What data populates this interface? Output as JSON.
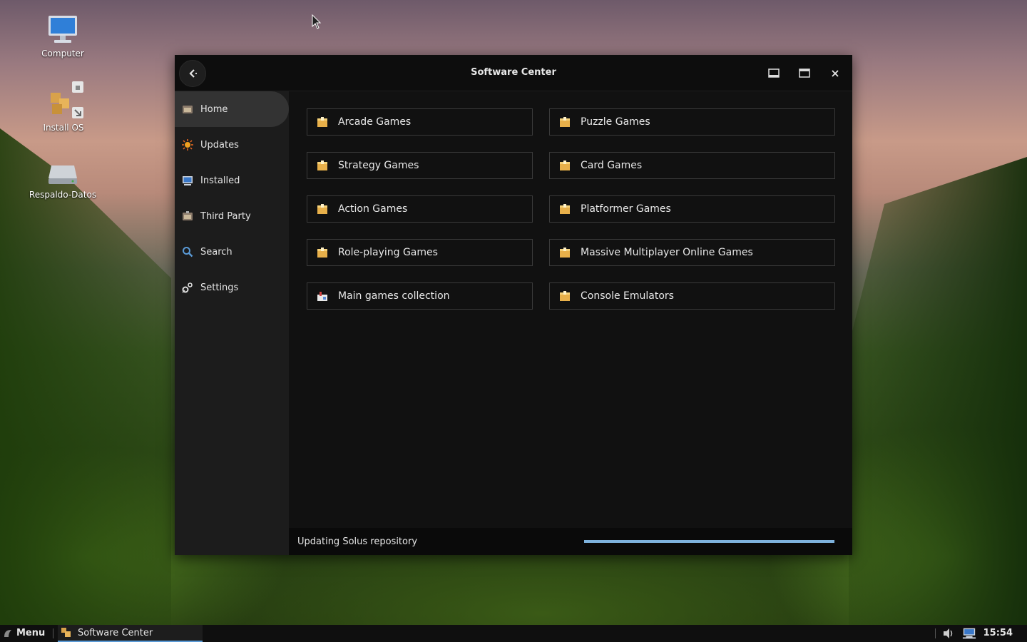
{
  "desktop": {
    "icons": [
      {
        "label": "Computer"
      },
      {
        "label": "Install OS"
      },
      {
        "label": "Respaldo-Datos"
      }
    ]
  },
  "window": {
    "title": "Software Center"
  },
  "sidebar": {
    "items": [
      {
        "label": "Home",
        "icon": "home-icon",
        "active": true
      },
      {
        "label": "Updates",
        "icon": "updates-icon"
      },
      {
        "label": "Installed",
        "icon": "installed-icon"
      },
      {
        "label": "Third Party",
        "icon": "third-party-icon"
      },
      {
        "label": "Search",
        "icon": "search-icon"
      },
      {
        "label": "Settings",
        "icon": "settings-icon"
      }
    ]
  },
  "categories": {
    "left": [
      {
        "label": "Arcade Games"
      },
      {
        "label": "Strategy Games"
      },
      {
        "label": "Action Games"
      },
      {
        "label": "Role-playing Games"
      },
      {
        "label": "Main games collection"
      }
    ],
    "right": [
      {
        "label": "Puzzle Games"
      },
      {
        "label": "Card Games"
      },
      {
        "label": "Platformer Games"
      },
      {
        "label": "Massive Multiplayer Online Games"
      },
      {
        "label": "Console Emulators"
      }
    ]
  },
  "status": {
    "text": "Updating Solus repository",
    "progress": 1.0,
    "progress_color": "#7fb3de"
  },
  "taskbar": {
    "menu_label": "Menu",
    "task_label": "Software Center",
    "clock": "15:54"
  },
  "colors": {
    "window_bg": "#111111",
    "sidebar_bg": "#1c1c1c",
    "folder_icon": "#e8b04a"
  }
}
